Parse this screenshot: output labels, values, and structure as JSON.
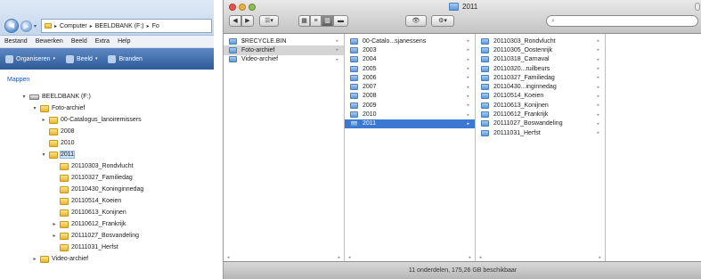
{
  "explorer": {
    "address_path": [
      "Computer",
      "BEELDBANK (F:)",
      "Fo"
    ],
    "menu": [
      "Bestand",
      "Bewerken",
      "Beeld",
      "Extra",
      "Help"
    ],
    "toolbar": [
      "Organiseren",
      "Beeld",
      "Branden"
    ],
    "pane_title": "Mappen",
    "tree": [
      {
        "label": "BEELDBANK (F:)",
        "level": 0,
        "icon": "drive-icon",
        "expander": "▾"
      },
      {
        "label": "Foto-archief",
        "level": 1,
        "icon": "folder-icon",
        "expander": "▾"
      },
      {
        "label": "00-Catalogus_lanoiremissers",
        "level": 2,
        "icon": "folder-icon",
        "expander": "▸"
      },
      {
        "label": "2008",
        "level": 2,
        "icon": "folder-icon",
        "expander": ""
      },
      {
        "label": "2010",
        "level": 2,
        "icon": "folder-icon",
        "expander": ""
      },
      {
        "label": "2011",
        "level": 2,
        "icon": "folder-icon",
        "expander": "▾",
        "selected": true
      },
      {
        "label": "20110303_Rondvlucht",
        "level": 3,
        "icon": "folder-icon",
        "expander": ""
      },
      {
        "label": "20110327_Familiedag",
        "level": 3,
        "icon": "folder-icon",
        "expander": ""
      },
      {
        "label": "20110430_Koninginnedag",
        "level": 3,
        "icon": "folder-icon",
        "expander": ""
      },
      {
        "label": "20110514_Koeien",
        "level": 3,
        "icon": "folder-icon",
        "expander": ""
      },
      {
        "label": "20110613_Konijnen",
        "level": 3,
        "icon": "folder-icon",
        "expander": ""
      },
      {
        "label": "20110612_Frankrijk",
        "level": 3,
        "icon": "folder-icon",
        "expander": "▸"
      },
      {
        "label": "20111027_Bosvandeling",
        "level": 3,
        "icon": "folder-icon",
        "expander": "▸"
      },
      {
        "label": "20111031_Herfst",
        "level": 3,
        "icon": "folder-icon",
        "expander": ""
      },
      {
        "label": "Video-archief",
        "level": 1,
        "icon": "folder-icon",
        "expander": "▸"
      }
    ]
  },
  "finder": {
    "title": "2011",
    "search_placeholder": "",
    "columns": [
      {
        "items": [
          {
            "label": "$RECYCLE.BIN",
            "arrow": true,
            "state": ""
          },
          {
            "label": "Foto-archief",
            "arrow": true,
            "state": "highlighted"
          },
          {
            "label": "Video-archief",
            "arrow": true,
            "state": ""
          }
        ]
      },
      {
        "items": [
          {
            "label": "00-Catalo...sjanessens",
            "arrow": true,
            "state": ""
          },
          {
            "label": "2003",
            "arrow": true,
            "state": ""
          },
          {
            "label": "2004",
            "arrow": true,
            "state": ""
          },
          {
            "label": "2005",
            "arrow": true,
            "state": ""
          },
          {
            "label": "2006",
            "arrow": true,
            "state": ""
          },
          {
            "label": "2007",
            "arrow": true,
            "state": ""
          },
          {
            "label": "2008",
            "arrow": true,
            "state": ""
          },
          {
            "label": "2009",
            "arrow": true,
            "state": ""
          },
          {
            "label": "2010",
            "arrow": true,
            "state": ""
          },
          {
            "label": "2011",
            "arrow": true,
            "state": "selected"
          }
        ]
      },
      {
        "items": [
          {
            "label": "20110303_Rondvlucht",
            "arrow": true,
            "state": ""
          },
          {
            "label": "20110305_Oostenrijk",
            "arrow": true,
            "state": ""
          },
          {
            "label": "20110318_Carnaval",
            "arrow": true,
            "state": ""
          },
          {
            "label": "20110320...ruilbeurs",
            "arrow": true,
            "state": ""
          },
          {
            "label": "20110327_Familiedag",
            "arrow": true,
            "state": ""
          },
          {
            "label": "20110430...inginnedag",
            "arrow": true,
            "state": ""
          },
          {
            "label": "20110514_Koeien",
            "arrow": true,
            "state": ""
          },
          {
            "label": "20110613_Konijnen",
            "arrow": true,
            "state": ""
          },
          {
            "label": "20110612_Frankrijk",
            "arrow": true,
            "state": ""
          },
          {
            "label": "20111027_Boswandeling",
            "arrow": true,
            "state": ""
          },
          {
            "label": "20111031_Herfst",
            "arrow": true,
            "state": ""
          }
        ]
      },
      {
        "items": []
      }
    ],
    "status": "11 onderdelen, 175,26 GB beschikbaar"
  },
  "colors": {
    "finder_selection": "#3a78d4",
    "finder_highlight": "#d5d5d5",
    "explorer_toolbar": "#2d5a99",
    "explorer_title_link": "#1f56a8"
  }
}
